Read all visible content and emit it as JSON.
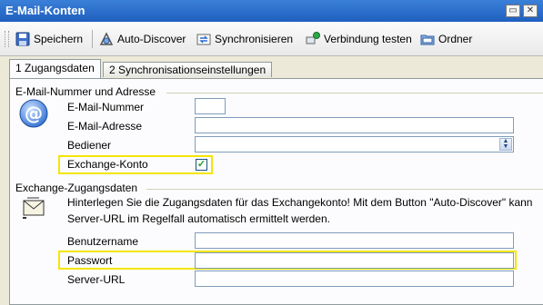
{
  "window": {
    "title": "E-Mail-Konten",
    "restore_glyph": "▭",
    "close_glyph": "✕"
  },
  "toolbar": {
    "items": [
      {
        "icon": "save-icon",
        "label": "Speichern"
      },
      {
        "icon": "auto-discover-icon",
        "label": "Auto-Discover"
      },
      {
        "icon": "sync-icon",
        "label": "Synchronisieren"
      },
      {
        "icon": "connection-test-icon",
        "label": "Verbindung testen"
      },
      {
        "icon": "folder-icon",
        "label": "Ordner"
      }
    ]
  },
  "tabs": [
    {
      "label": "1 Zugangsdaten",
      "active": true
    },
    {
      "label": "2 Synchronisationseinstellungen",
      "active": false
    }
  ],
  "email_section": {
    "title": "E-Mail-Nummer und Adresse",
    "icon": "at-sign-icon",
    "fields": {
      "number_label": "E-Mail-Nummer",
      "number_value": "",
      "address_label": "E-Mail-Adresse",
      "address_value": "",
      "operator_label": "Bediener",
      "operator_value": "",
      "exchange_label": "Exchange-Konto",
      "exchange_checked": true,
      "check_glyph": "✓"
    }
  },
  "exchange_section": {
    "title": "Exchange-Zugangsdaten",
    "icon": "envelope-icon",
    "info_line1": "Hinterlegen Sie die Zugangsdaten für das Exchangekonto! Mit dem Button \"Auto-Discover\" kann",
    "info_line2": "Server-URL im Regelfall automatisch ermittelt werden.",
    "fields": {
      "username_label": "Benutzername",
      "username_value": "",
      "password_label": "Passwort",
      "password_value": "",
      "server_label": "Server-URL",
      "server_value": ""
    }
  },
  "colors": {
    "titlebar": "#2a6fd0",
    "highlight": "#f3e600",
    "checkmark": "#21a121"
  }
}
